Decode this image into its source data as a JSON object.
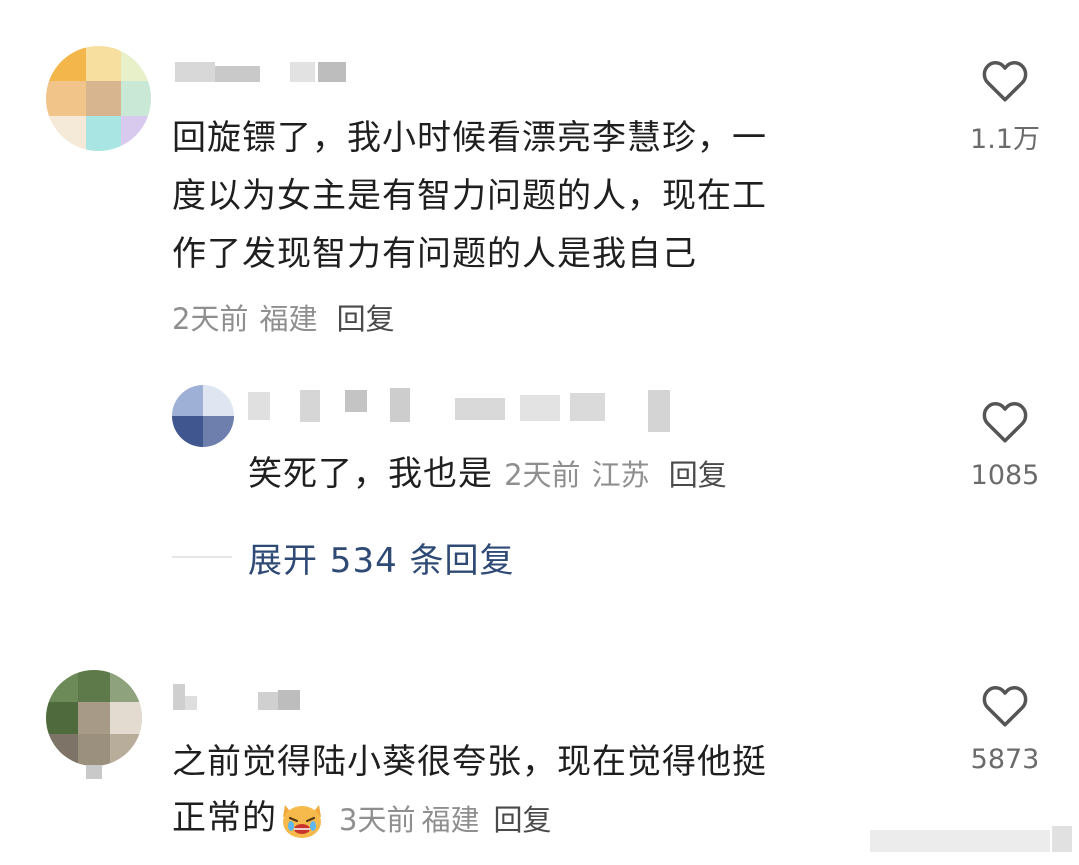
{
  "comments": [
    {
      "text_lines": [
        "回旋镖了，我小时候看漂亮李慧珍，一",
        "度以为女主是有智力问题的人，现在工",
        "作了发现智力有问题的人是我自己"
      ],
      "time": "2天前",
      "location": "福建",
      "reply_label": "回复",
      "likes": "1.1万",
      "replies": [
        {
          "text": "笑死了，我也是",
          "time": "2天前",
          "location": "江苏",
          "reply_label": "回复",
          "likes": "1085"
        }
      ],
      "expand_label": "展开 534 条回复"
    },
    {
      "text_lines": [
        "之前觉得陆小葵很夸张，现在觉得他挺",
        "正常的"
      ],
      "time": "3天前",
      "location": "福建",
      "reply_label": "回复",
      "likes": "5873"
    }
  ],
  "icons": {
    "like": "heart-outline-icon",
    "emoji": "crying-cat-emoji-icon"
  },
  "colors": {
    "text": "#1f1f1f",
    "meta": "#8f8f8f",
    "expand": "#2f4a75"
  }
}
